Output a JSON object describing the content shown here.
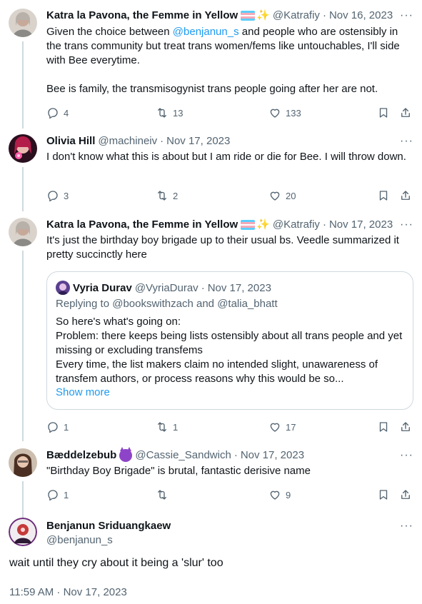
{
  "icons": {
    "reply": "reply-icon",
    "retweet": "retweet-icon",
    "like": "heart-icon",
    "bookmark": "bookmark-icon",
    "share": "share-icon",
    "more": "more-icon"
  },
  "colors": {
    "link": "#1d9bf0",
    "secondary": "#536471",
    "text": "#0f1419",
    "border": "#cfd9de"
  },
  "tweets": [
    {
      "name": "Katra la Pavona, the Femme in Yellow",
      "handle": "@Katrafiy",
      "date": "Nov 16, 2023",
      "text_prefix": "Given the choice between ",
      "mention": "@benjanun_s",
      "text_suffix": " and people who are ostensibly in the trans community but treat trans women/fems like untouchables, I'll side with Bee everytime.\n\nBee is family, the transmisogynist trans people going after her are not.",
      "replies": "4",
      "retweets": "13",
      "likes": "133"
    },
    {
      "name": "Olivia Hill",
      "handle": "@machineiv",
      "date": "Nov 17, 2023",
      "text": "I don't know what this is about but I am ride or die for Bee. I will throw down.",
      "replies": "3",
      "retweets": "2",
      "likes": "20"
    },
    {
      "name": "Katra la Pavona, the Femme in Yellow",
      "handle": "@Katrafiy",
      "date": "Nov 17, 2023",
      "text": "It's just the birthday boy brigade up to their usual bs. Veedle summarized it pretty succinctly here",
      "quote": {
        "name": "Vyria Durav",
        "handle": "@VyriaDurav",
        "date": "Nov 17, 2023",
        "replying_prefix": "Replying to ",
        "replying_to": "@bookswithzach and @talia_bhatt",
        "text": "So here's what's going on:\nProblem: there keeps being lists ostensibly about all trans people and yet missing or excluding transfems\nEvery time, the list makers claim no intended slight, unawareness of transfem authors, or process reasons why this would be so...",
        "show_more": "Show more"
      },
      "replies": "1",
      "retweets": "1",
      "likes": "17"
    },
    {
      "name": "Bæddelzebub",
      "handle": "@Cassie_Sandwich",
      "date": "Nov 17, 2023",
      "text": "\"Birthday Boy Brigade\" is brutal, fantastic derisive name",
      "replies": "1",
      "retweets": "",
      "likes": "9"
    }
  ],
  "main": {
    "name": "Benjanun Sriduangkaew",
    "handle": "@benjanun_s",
    "text": "wait until they cry about it being a 'slur' too",
    "timestamp": "11:59 AM · Nov 17, 2023"
  },
  "dot": "·",
  "more_glyph": "···",
  "sparkle_glyph": "✨"
}
